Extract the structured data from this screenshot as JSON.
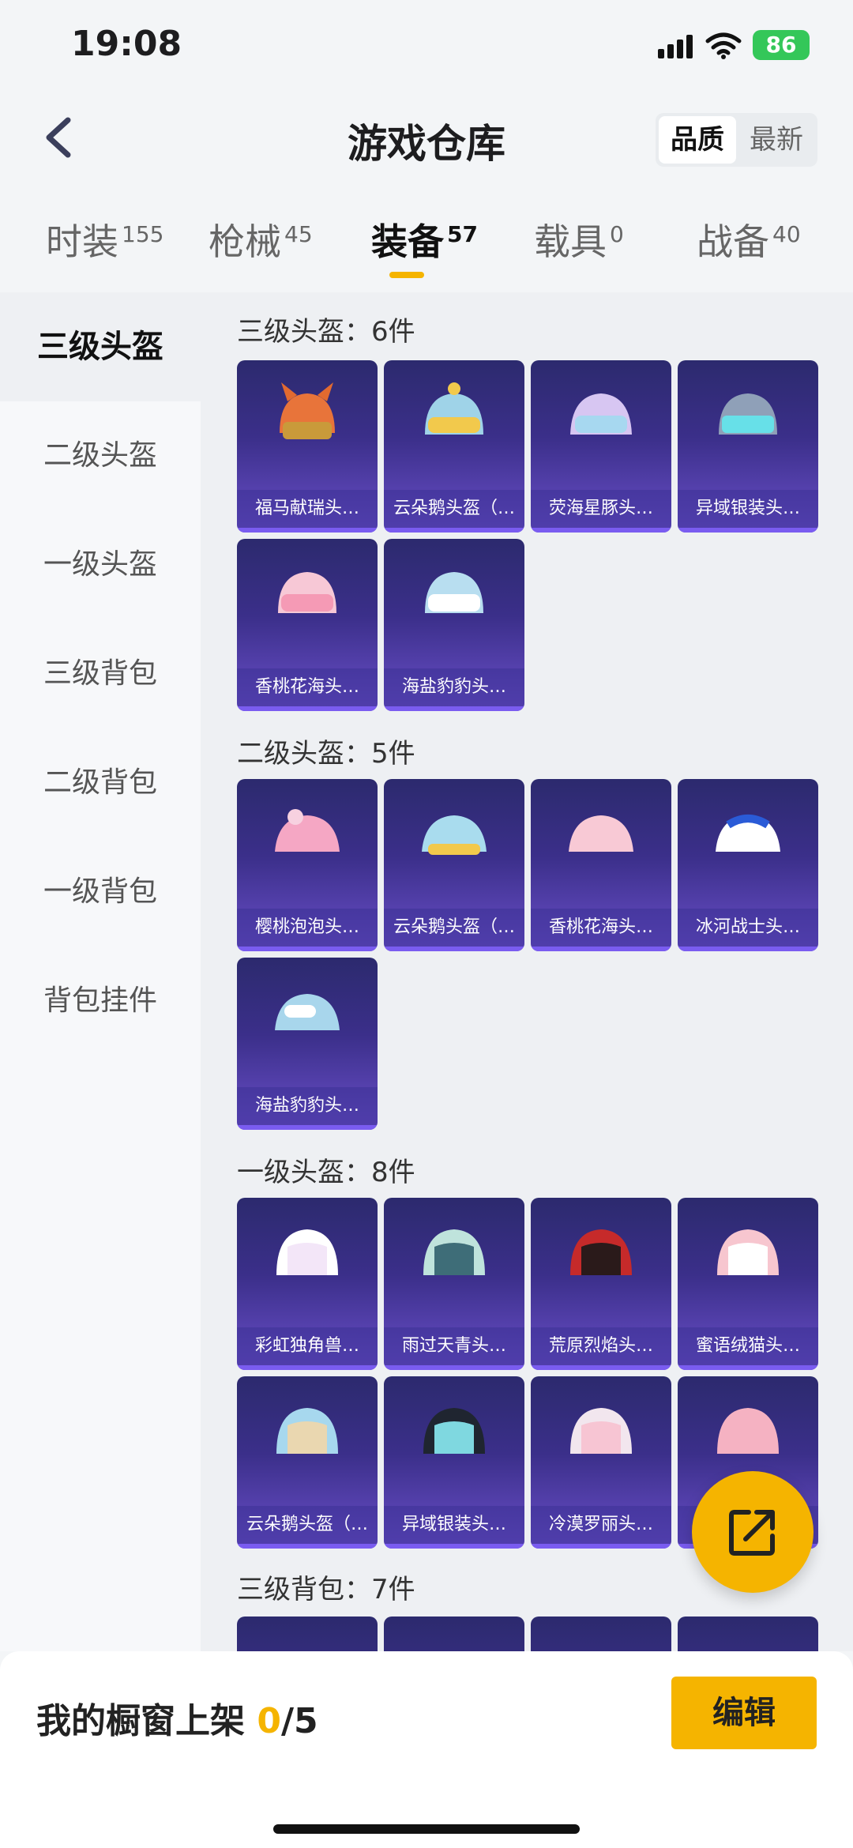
{
  "status_bar": {
    "time": "19:08",
    "battery": "86"
  },
  "header": {
    "title": "游戏仓库",
    "sort_options": [
      "品质",
      "最新"
    ]
  },
  "tabs": [
    {
      "label": "时装",
      "count": "155"
    },
    {
      "label": "枪械",
      "count": "45"
    },
    {
      "label": "装备",
      "count": "57"
    },
    {
      "label": "载具",
      "count": "0"
    },
    {
      "label": "战备",
      "count": "40"
    }
  ],
  "sidebar": {
    "items": [
      "三级头盔",
      "二级头盔",
      "一级头盔",
      "三级背包",
      "二级背包",
      "一级背包",
      "背包挂件"
    ]
  },
  "sections": [
    {
      "title": "三级头盔：6件",
      "items": [
        "福马献瑞头…",
        "云朵鹅头盔（…",
        "荧海星豚头…",
        "异域银装头…",
        "香桃花海头…",
        "海盐豹豹头…"
      ]
    },
    {
      "title": "二级头盔：5件",
      "items": [
        "樱桃泡泡头…",
        "云朵鹅头盔（…",
        "香桃花海头…",
        "冰河战士头…",
        "海盐豹豹头…"
      ]
    },
    {
      "title": "一级头盔：8件",
      "items": [
        "彩虹独角兽…",
        "雨过天青头…",
        "荒原烈焰头…",
        "蜜语绒猫头…",
        "云朵鹅头盔（…",
        "异域银装头…",
        "冷漠罗丽头…",
        ""
      ]
    },
    {
      "title": "三级背包：7件",
      "items": []
    }
  ],
  "bottom_bar": {
    "label": "我的橱窗上架",
    "count": "0",
    "total": "/5",
    "edit_label": "编辑"
  },
  "colors": {
    "accent": "#f5b400",
    "tile_gradient_top": "#2c2a6e",
    "tile_gradient_bottom": "#6a4fc9"
  }
}
